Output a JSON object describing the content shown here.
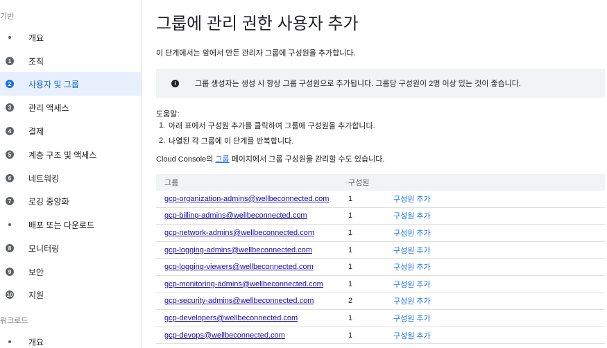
{
  "sidebar": {
    "sections": [
      {
        "label": "기반"
      },
      {
        "label": "워크로드"
      }
    ],
    "items": [
      {
        "marker": "dot",
        "num": "",
        "label": "개요"
      },
      {
        "marker": "num",
        "num": "1",
        "label": "조직"
      },
      {
        "marker": "num",
        "num": "2",
        "label": "사용자 및 그룹",
        "active": true
      },
      {
        "marker": "num",
        "num": "3",
        "label": "관리 액세스"
      },
      {
        "marker": "num",
        "num": "4",
        "label": "결제"
      },
      {
        "marker": "num",
        "num": "5",
        "label": "계층 구조 및 액세스"
      },
      {
        "marker": "num",
        "num": "6",
        "label": "네트워킹"
      },
      {
        "marker": "num",
        "num": "7",
        "label": "로깅 중앙화"
      },
      {
        "marker": "dot",
        "num": "",
        "label": "배포 또는 다운로드"
      },
      {
        "marker": "num",
        "num": "8",
        "label": "모니터링"
      },
      {
        "marker": "num",
        "num": "9",
        "label": "보안"
      },
      {
        "marker": "num",
        "num": "10",
        "label": "지원"
      },
      {
        "marker": "dot",
        "num": "",
        "label": "개요"
      }
    ]
  },
  "main": {
    "title": "그룹에 관리 권한 사용자 추가",
    "intro": "이 단계에서는 앞에서 만든 관리자 그룹에 구성원을 추가합니다.",
    "info": {
      "icon": "info-icon",
      "text": "그룹 생성자는 생성 시 항상 그룹 구성원으로 추가됩니다. 그룹당 구성원이 2명 이상 있는 것이 좋습니다."
    },
    "help": {
      "heading": "도움말:",
      "steps": [
        {
          "num": "1.",
          "text": "아래 표에서 구성원 추가를 클릭하여 그룹에 구성원을 추가합니다."
        },
        {
          "num": "2.",
          "text": "나열된 각 그룹에 이 단계를 반복합니다."
        }
      ]
    },
    "console_line": {
      "prefix": "Cloud Console의 ",
      "link": "그룹",
      "suffix": " 페이지에서 그룹 구성원을 관리할 수도 있습니다."
    },
    "table": {
      "headers": {
        "group": "그룹",
        "members": "구성원"
      },
      "rows": [
        {
          "group": "gcp-organization-admins@wellbeconnected.com",
          "members": "1",
          "action": "구성원 추가"
        },
        {
          "group": "gcp-billing-admins@wellbeconnected.com",
          "members": "1",
          "action": "구성원 추가"
        },
        {
          "group": "gcp-network-admins@wellbeconnected.com",
          "members": "1",
          "action": "구성원 추가"
        },
        {
          "group": "gcp-logging-admins@wellbeconnected.com",
          "members": "1",
          "action": "구성원 추가"
        },
        {
          "group": "gcp-logging-viewers@wellbeconnected.com",
          "members": "1",
          "action": "구성원 추가"
        },
        {
          "group": "gcp-monitoring-admins@wellbeconnected.com",
          "members": "1",
          "action": "구성원 추가"
        },
        {
          "group": "gcp-security-admins@wellbeconnected.com",
          "members": "2",
          "action": "구성원 추가"
        },
        {
          "group": "gcp-developers@wellbeconnected.com",
          "members": "1",
          "action": "구성원 추가"
        },
        {
          "group": "gcp-devops@wellbeconnected.com",
          "members": "1",
          "action": "구성원 추가"
        }
      ]
    }
  },
  "colors": {
    "accent": "#1a73e8",
    "active_bg": "#e8f0fe",
    "info_bg": "#f1f3f4",
    "link": "#1a0dab"
  }
}
